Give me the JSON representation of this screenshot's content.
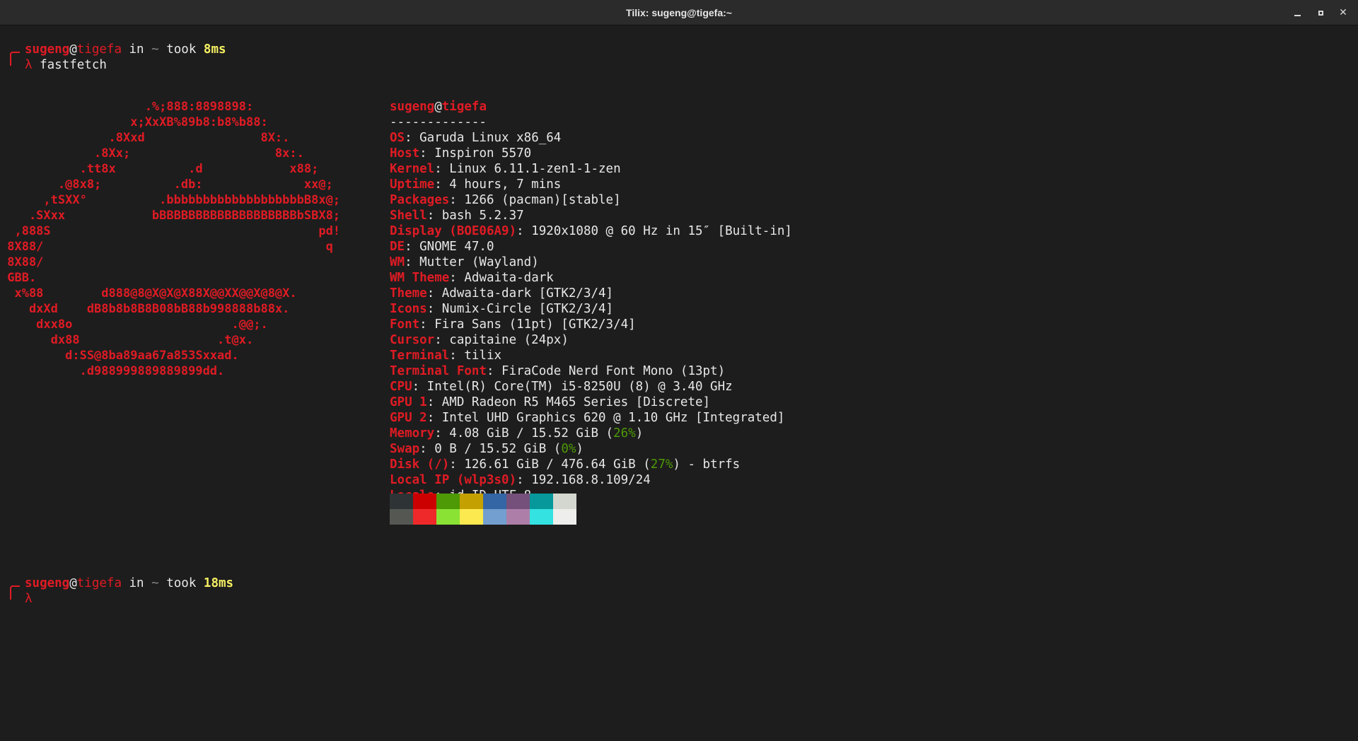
{
  "window": {
    "title": "Tilix: sugeng@tigefa:~"
  },
  "prompt1": {
    "user": "sugeng",
    "at": "@",
    "host": "tigefa",
    "in": " in ",
    "dir": "~",
    "took": " took ",
    "time": "8ms",
    "lambda": "λ",
    "command": " fastfetch"
  },
  "prompt2": {
    "user": "sugeng",
    "at": "@",
    "host": "tigefa",
    "in": " in ",
    "dir": "~",
    "took": " took ",
    "time": "18ms",
    "lambda": "λ"
  },
  "logo_lines": [
    "                    .%;888:8898898:",
    "                  x;XxXB%89b8:b8%b88:",
    "               .8Xxd                8X:.",
    "             .8Xx;                    8x:.",
    "           .tt8x          .d            x88;",
    "        .@8x8;          .db:              xx@;",
    "      ,tSXX°          .bbbbbbbbbbbbbbbbbbbB8x@;",
    "    .SXxx            bBBBBBBBBBBBBBBBBBBBbSBX8;",
    "  ,888S                                     pd!",
    " 8X88/                                       q",
    " 8X88/",
    " GBB.",
    "  x%88        d888@8@X@X@X88X@@XX@@X@8@X.",
    "    dxXd    dB8b8b8B8B08bB88b998888b88x.",
    "     dxx8o                      .@@;.",
    "       dx88                   .t@x.",
    "         d:SS@8ba89aa67a853Sxxad.",
    "           .d988999889889899dd."
  ],
  "info": {
    "user": "sugeng",
    "at": "@",
    "host": "tigefa",
    "separator": "-------------",
    "rows": [
      {
        "key": "OS",
        "value": ": Garuda Linux x86_64"
      },
      {
        "key": "Host",
        "value": ": Inspiron 5570"
      },
      {
        "key": "Kernel",
        "value": ": Linux 6.11.1-zen1-1-zen"
      },
      {
        "key": "Uptime",
        "value": ": 4 hours, 7 mins"
      },
      {
        "key": "Packages",
        "value": ": 1266 (pacman)[stable]"
      },
      {
        "key": "Shell",
        "value": ": bash 5.2.37"
      },
      {
        "key": "Display (BOE06A9)",
        "value": ": 1920x1080 @ 60 Hz in 15″ [Built-in]"
      },
      {
        "key": "DE",
        "value": ": GNOME 47.0"
      },
      {
        "key": "WM",
        "value": ": Mutter (Wayland)"
      },
      {
        "key": "WM Theme",
        "value": ": Adwaita-dark"
      },
      {
        "key": "Theme",
        "value": ": Adwaita-dark [GTK2/3/4]"
      },
      {
        "key": "Icons",
        "value": ": Numix-Circle [GTK2/3/4]"
      },
      {
        "key": "Font",
        "value": ": Fira Sans (11pt) [GTK2/3/4]"
      },
      {
        "key": "Cursor",
        "value": ": capitaine (24px)"
      },
      {
        "key": "Terminal",
        "value": ": tilix"
      },
      {
        "key": "Terminal Font",
        "value": ": FiraCode Nerd Font Mono (13pt)"
      },
      {
        "key": "CPU",
        "value": ": Intel(R) Core(TM) i5-8250U (8) @ 3.40 GHz"
      },
      {
        "key": "GPU 1",
        "value": ": AMD Radeon R5 M465 Series [Discrete]"
      },
      {
        "key": "GPU 2",
        "value": ": Intel UHD Graphics 620 @ 1.10 GHz [Integrated]"
      }
    ],
    "memory": {
      "key": "Memory",
      "pre": ": 4.08 GiB / 15.52 GiB (",
      "pct": "26%",
      "post": ")"
    },
    "swap": {
      "key": "Swap",
      "pre": ": 0 B / 15.52 GiB (",
      "pct": "0%",
      "post": ")"
    },
    "disk": {
      "key": "Disk (/)",
      "pre": ": 126.61 GiB / 476.64 GiB (",
      "pct": "27%",
      "post": ") - btrfs"
    },
    "local_ip": {
      "key": "Local IP (wlp3s0)",
      "value": ": 192.168.8.109/24"
    },
    "locale": {
      "key": "Locale",
      "value": ": id_ID.UTF-8"
    }
  },
  "palette": {
    "normal": [
      "#2e3436",
      "#cc0000",
      "#4e9a06",
      "#c4a000",
      "#3465a4",
      "#75507b",
      "#06989a",
      "#d3d7cf"
    ],
    "bright": [
      "#555753",
      "#ef2929",
      "#8ae234",
      "#fce94f",
      "#729fcf",
      "#ad7fa8",
      "#34e2e2",
      "#eeeeec"
    ]
  },
  "colors": {
    "background": "#1d1d1d",
    "accent_red": "#e01b24",
    "yellow": "#f6f063",
    "green": "#4e9a06"
  }
}
